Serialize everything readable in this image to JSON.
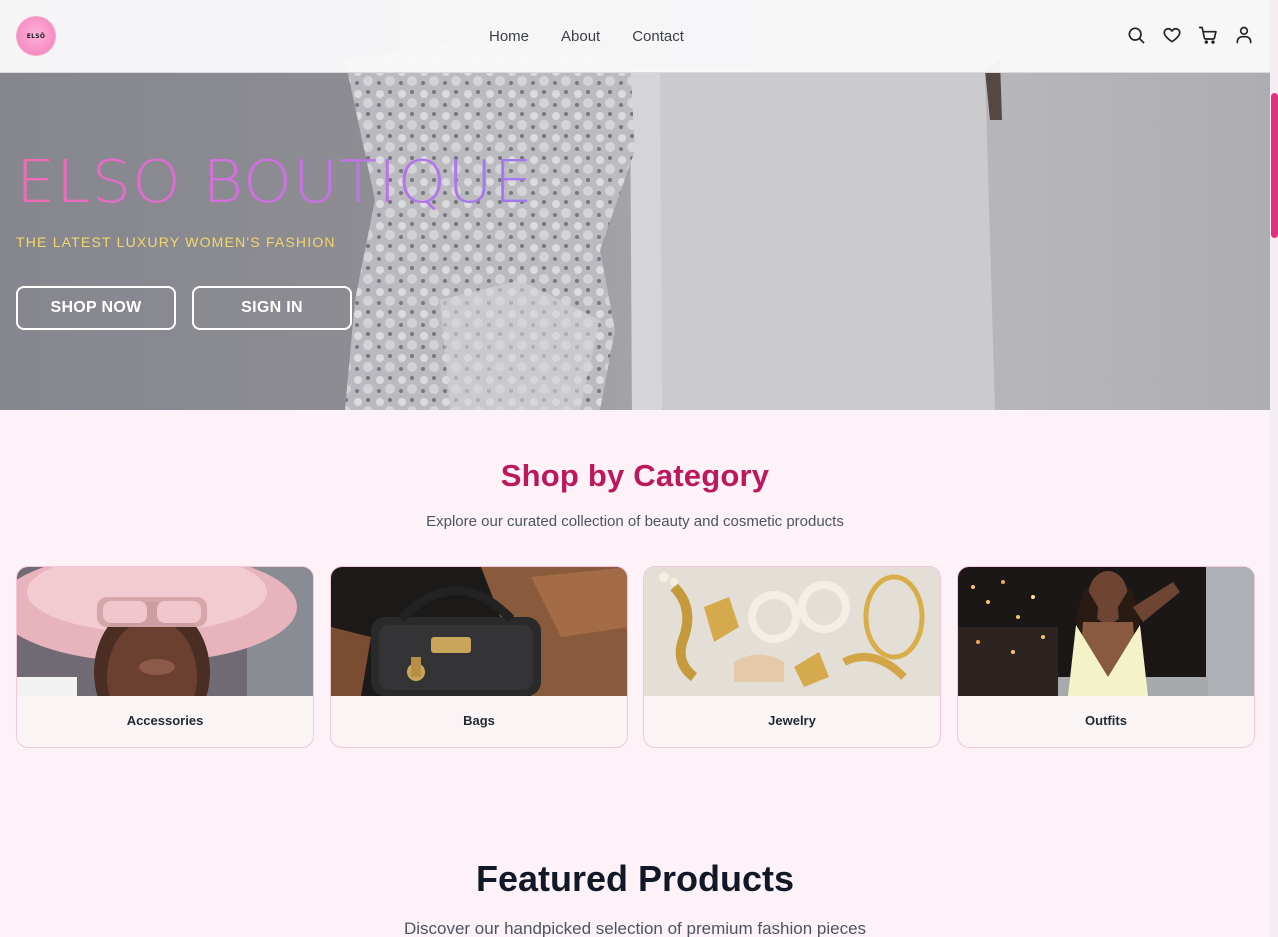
{
  "brand": {
    "logo_text": "ELSŌ"
  },
  "nav": {
    "items": [
      "Home",
      "About",
      "Contact"
    ]
  },
  "header_icons": [
    "search-icon",
    "heart-icon",
    "cart-icon",
    "user-icon"
  ],
  "hero": {
    "title": "ELSO BOUTIQUE",
    "subtitle": "THE LATEST LUXURY WOMEN'S FASHION",
    "shop_button": "SHOP NOW",
    "signin_button": "SIGN IN"
  },
  "categories": {
    "title": "Shop by Category",
    "subtitle": "Explore our curated collection of beauty and cosmetic products",
    "items": [
      {
        "label": "Accessories"
      },
      {
        "label": "Bags"
      },
      {
        "label": "Jewelry"
      },
      {
        "label": "Outfits"
      }
    ]
  },
  "featured": {
    "title": "Featured Products",
    "subtitle": "Discover our handpicked selection of premium fashion pieces"
  },
  "colors": {
    "accent": "#be185d",
    "scroll_thumb": "#e0327f",
    "hero_subtitle": "#f3d76a",
    "page_bg": "#fdf2f8"
  }
}
